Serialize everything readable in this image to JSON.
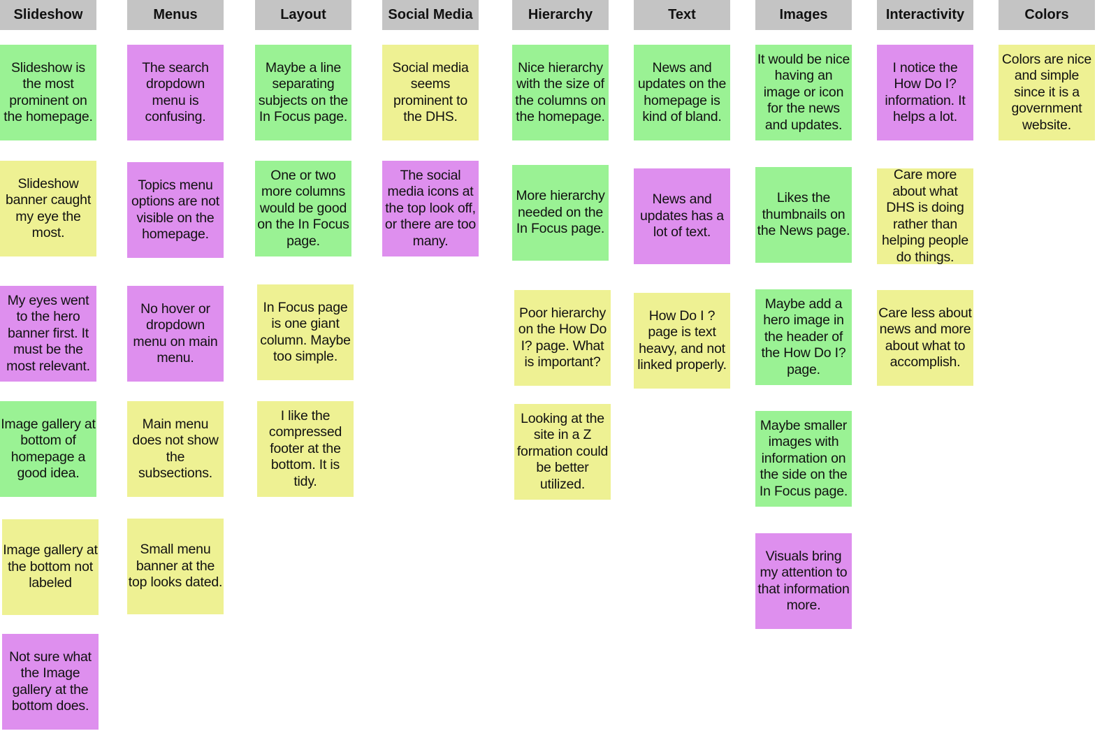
{
  "colors": {
    "header": "#c4c4c4",
    "green": "#9af294",
    "yellow": "#eef193",
    "purple": "#de8fee"
  },
  "columns": [
    {
      "title": "Slideshow",
      "notes": [
        {
          "text": "Slideshow is the most prominent on the homepage.",
          "color": "green"
        },
        {
          "text": "Slideshow banner caught my eye the most.",
          "color": "yellow"
        },
        {
          "text": "My eyes went to the hero banner first. It must be the most relevant.",
          "color": "purple"
        },
        {
          "text": "Image gallery at bottom of homepage a good idea.",
          "color": "green"
        },
        {
          "text": "Image gallery at the bottom not labeled",
          "color": "yellow"
        },
        {
          "text": "Not sure what the Image gallery at the bottom does.",
          "color": "purple"
        }
      ]
    },
    {
      "title": "Menus",
      "notes": [
        {
          "text": "The search dropdown menu is confusing.",
          "color": "purple"
        },
        {
          "text": "Topics menu options are not visible on the homepage.",
          "color": "purple"
        },
        {
          "text": "No hover or dropdown menu on main menu.",
          "color": "purple"
        },
        {
          "text": "Main menu does not show the subsections.",
          "color": "yellow"
        },
        {
          "text": "Small menu banner at the top looks dated.",
          "color": "yellow"
        }
      ]
    },
    {
      "title": "Layout",
      "notes": [
        {
          "text": "Maybe a line separating subjects on the In Focus page.",
          "color": "green"
        },
        {
          "text": "One or two more columns would be good on the In Focus page.",
          "color": "green"
        },
        {
          "text": "In Focus page is one giant column. Maybe too simple.",
          "color": "yellow"
        },
        {
          "text": "I like the compressed footer at the bottom. It is tidy.",
          "color": "yellow"
        }
      ]
    },
    {
      "title": "Social Media",
      "notes": [
        {
          "text": "Social media seems prominent to the DHS.",
          "color": "yellow"
        },
        {
          "text": "The social media icons at the top look off, or there are too many.",
          "color": "purple"
        }
      ]
    },
    {
      "title": "Hierarchy",
      "notes": [
        {
          "text": "Nice hierarchy with the size of the columns on the homepage.",
          "color": "green"
        },
        {
          "text": "More hierarchy needed on the In Focus page.",
          "color": "green"
        },
        {
          "text": "Poor hierarchy on the How Do I? page. What is important?",
          "color": "yellow"
        },
        {
          "text": "Looking at the site in a Z formation could be better utilized.",
          "color": "yellow"
        }
      ]
    },
    {
      "title": "Text",
      "notes": [
        {
          "text": "News and updates on the homepage is kind of bland.",
          "color": "green"
        },
        {
          "text": "News and updates has a lot of text.",
          "color": "purple"
        },
        {
          "text": "How Do I ? page is text heavy, and not linked properly.",
          "color": "yellow"
        }
      ]
    },
    {
      "title": "Images",
      "notes": [
        {
          "text": "It would be nice having an image or icon for the news and updates.",
          "color": "green"
        },
        {
          "text": "Likes the thumbnails on the News page.",
          "color": "green"
        },
        {
          "text": "Maybe add a hero image in the header of the How Do I? page.",
          "color": "green"
        },
        {
          "text": "Maybe smaller images with information on the side on the In Focus page.",
          "color": "green"
        },
        {
          "text": "Visuals bring my attention to that information more.",
          "color": "purple"
        }
      ]
    },
    {
      "title": "Interactivity",
      "notes": [
        {
          "text": "I notice the How Do I? information. It helps a lot.",
          "color": "purple"
        },
        {
          "text": "Care more about what DHS is doing rather than helping people do things.",
          "color": "yellow"
        },
        {
          "text": "Care less about news and more about what to accomplish.",
          "color": "yellow"
        }
      ]
    },
    {
      "title": "Colors",
      "notes": [
        {
          "text": "Colors are nice and simple since it is a government website.",
          "color": "yellow"
        }
      ]
    }
  ]
}
